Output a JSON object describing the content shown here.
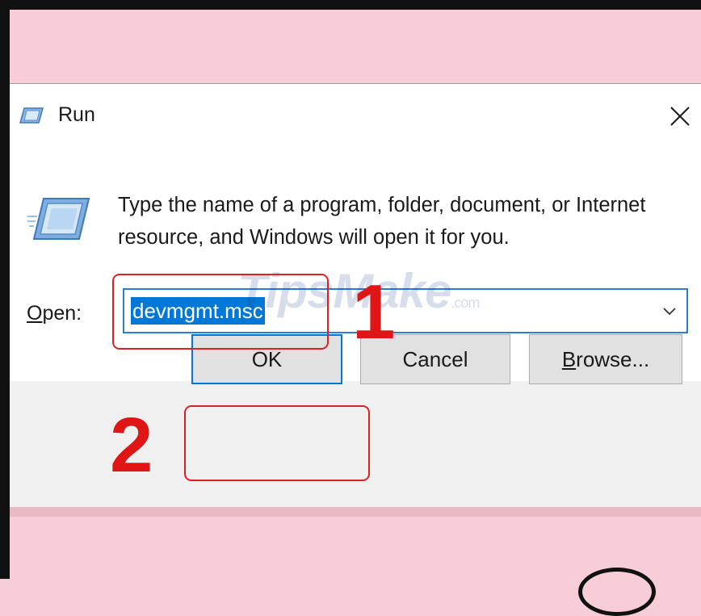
{
  "dialog": {
    "title": "Run",
    "close_glyph": "✕",
    "description": "Type the name of a program, folder, document, or Internet resource, and Windows will open it for you.",
    "open_label_accesskey": "O",
    "open_label_rest": "pen:",
    "open_value": "devmgmt.msc",
    "buttons": {
      "ok": "OK",
      "cancel": "Cancel",
      "browse_accesskey": "B",
      "browse_rest": "rowse..."
    }
  },
  "watermark": {
    "brand": "TipsMake",
    "domain": ".com"
  },
  "annotations": {
    "step1": "1",
    "step2": "2"
  },
  "icons": [
    "run-icon",
    "close-icon",
    "run-large-icon",
    "chevron-down-icon"
  ],
  "colors": {
    "background": "#f7cdd8",
    "selection": "#0078d7",
    "focus_border": "#2b7cd3",
    "annotation": "#e01616"
  }
}
